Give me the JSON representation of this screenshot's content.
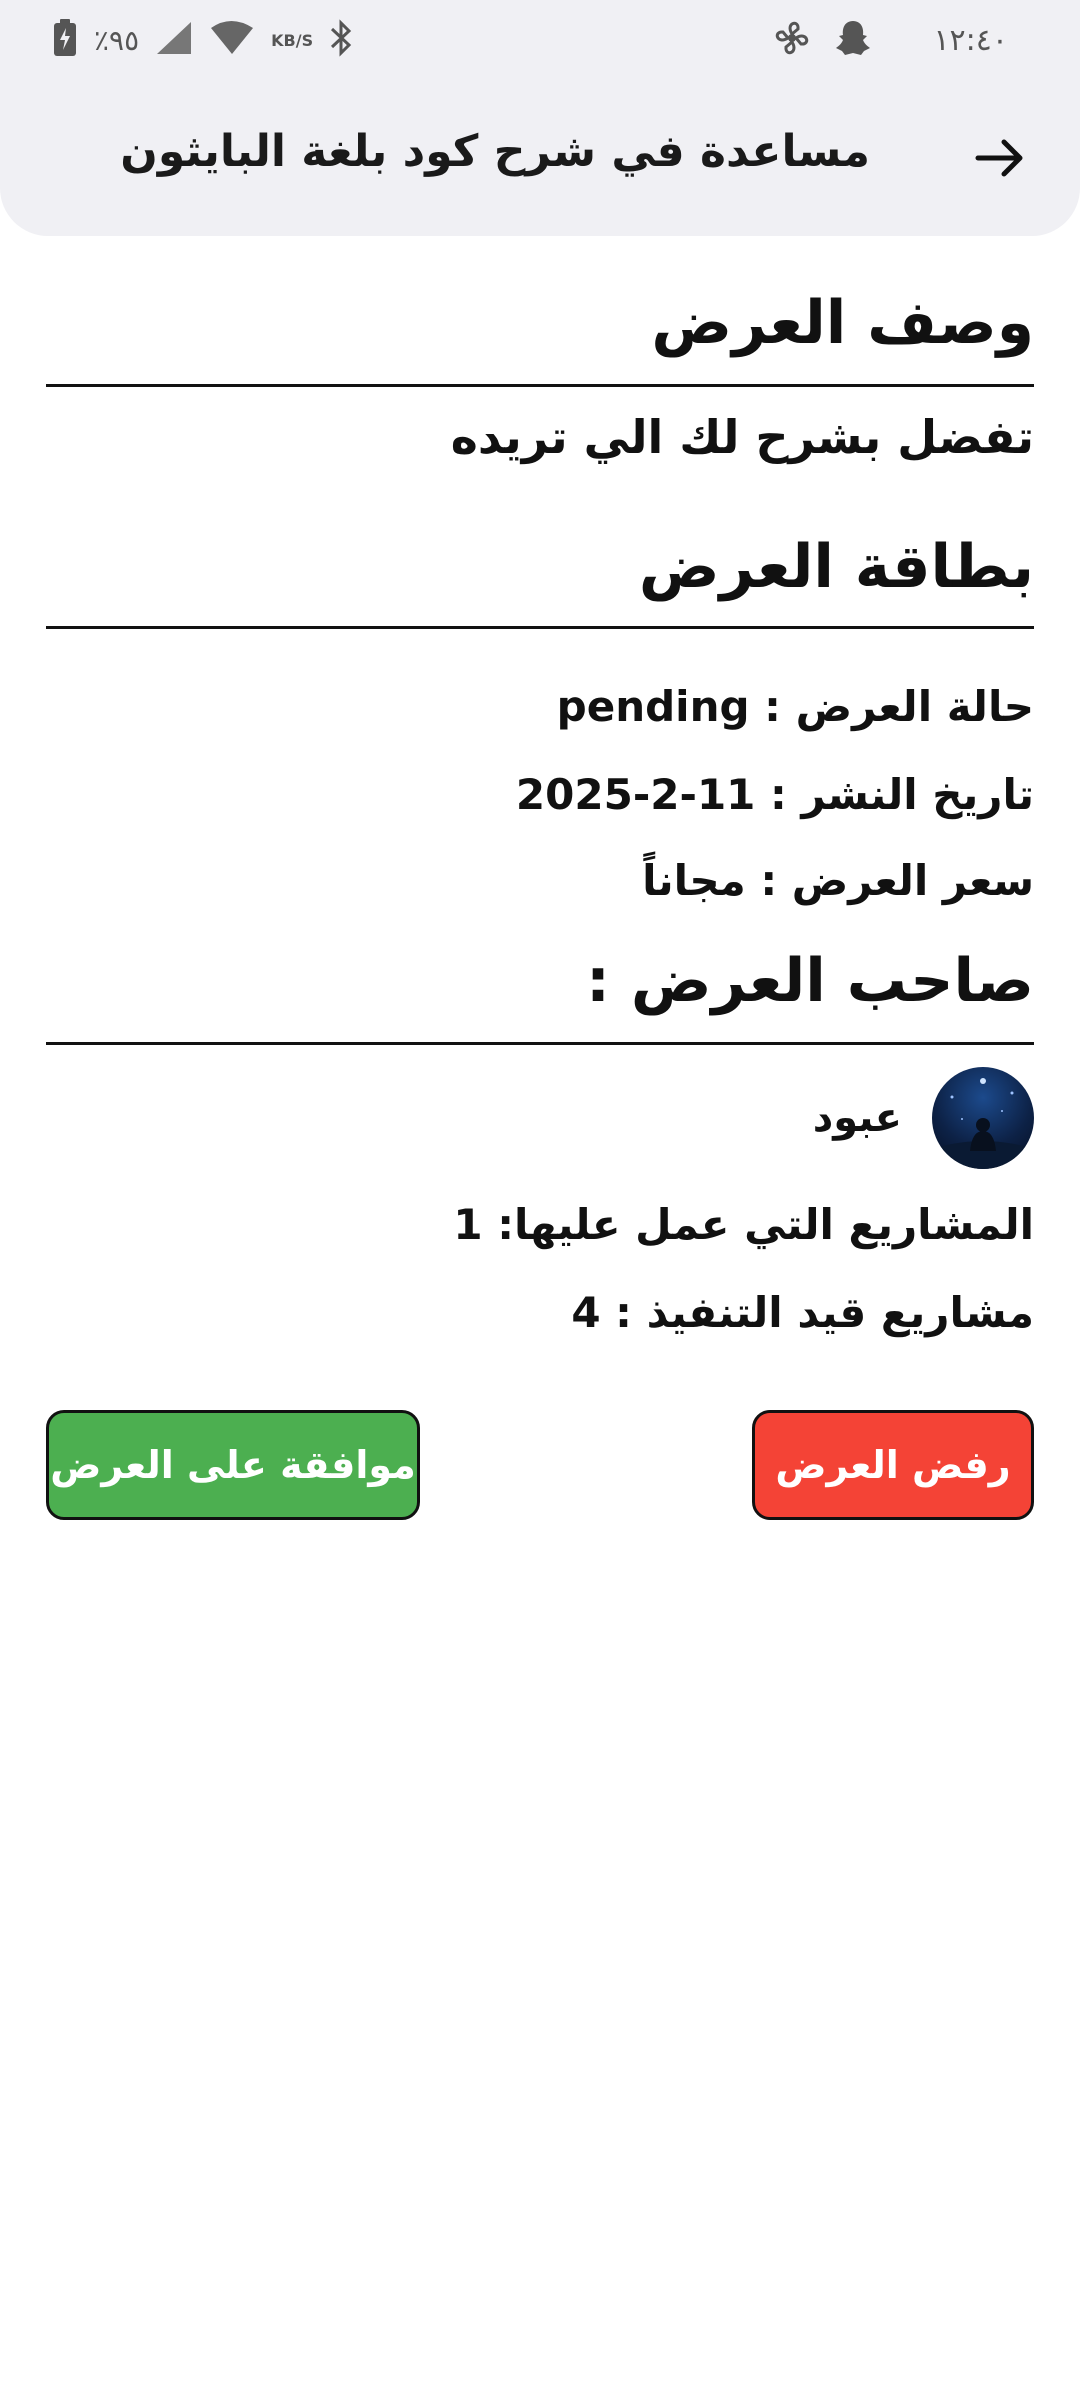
{
  "status_bar": {
    "time": "١٢:٤٠",
    "battery_percent": "٪٩٥",
    "net_speed_unit": "KB/S",
    "icons": [
      "battery-icon",
      "signal-icon",
      "wifi-icon",
      "bluetooth-icon",
      "snapchat-icon",
      "fan-icon"
    ]
  },
  "header": {
    "title": "مساعدة في شرح كود بلغة البايثون",
    "back_icon": "arrow-right-icon"
  },
  "offer_description": {
    "title": "وصف العرض",
    "text": "تفضل بشرح لك الي تريده"
  },
  "offer_card": {
    "title": "بطاقة العرض",
    "status_line": "حالة العرض : pending",
    "date_line": "تاريخ النشر :  11-2-2025",
    "price_line": "سعر العرض : مجاناً"
  },
  "owner": {
    "title": "صاحب العرض :",
    "name": "عبود",
    "projects_worked_line": "المشاريع التي عمل عليها: 1",
    "projects_in_progress_line": "مشاريع قيد التنفيذ : 4"
  },
  "actions": {
    "accept_label": "موافقة على العرض",
    "reject_label": "رفض العرض",
    "accept_color": "#4caf50",
    "reject_color": "#f44336"
  }
}
